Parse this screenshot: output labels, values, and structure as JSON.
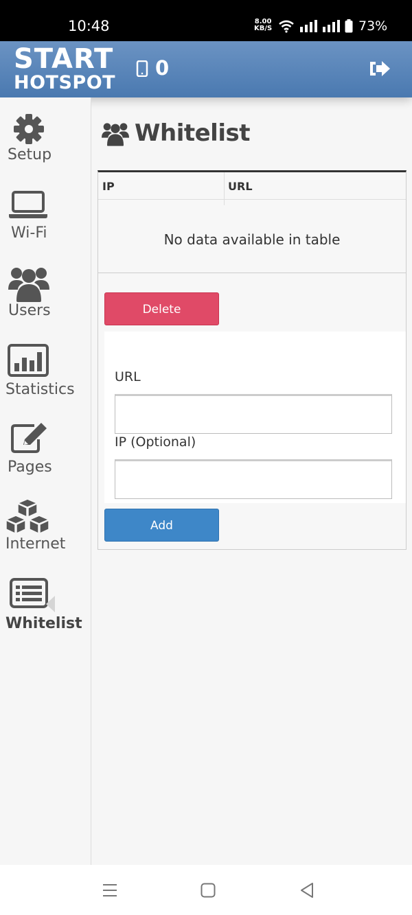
{
  "status_bar": {
    "time": "10:48",
    "speed_value": "8.00",
    "speed_unit": "KB/S",
    "battery": "73%"
  },
  "header": {
    "logo_top": "START",
    "logo_bottom": "HOTSPOT",
    "device_count": "0",
    "colors": {
      "header": "#5a86ba"
    }
  },
  "sidebar": {
    "items": [
      {
        "label": "Setup",
        "icon": "gear-icon"
      },
      {
        "label": "Wi-Fi",
        "icon": "laptop-icon"
      },
      {
        "label": "Users",
        "icon": "users-icon"
      },
      {
        "label": "Statistics",
        "icon": "bar-chart-icon"
      },
      {
        "label": "Pages",
        "icon": "edit-icon"
      },
      {
        "label": "Internet",
        "icon": "cubes-icon"
      },
      {
        "label": "Whitelist",
        "icon": "list-icon",
        "active": true
      }
    ]
  },
  "main": {
    "title": "Whitelist",
    "table": {
      "columns": [
        "IP",
        "URL"
      ],
      "empty_message": "No data available in table"
    },
    "delete_label": "Delete",
    "form": {
      "url_label": "URL",
      "url_value": "",
      "ip_label": "IP (Optional)",
      "ip_value": ""
    },
    "add_label": "Add",
    "colors": {
      "delete": "#e04a67",
      "add": "#3e87c8"
    }
  }
}
